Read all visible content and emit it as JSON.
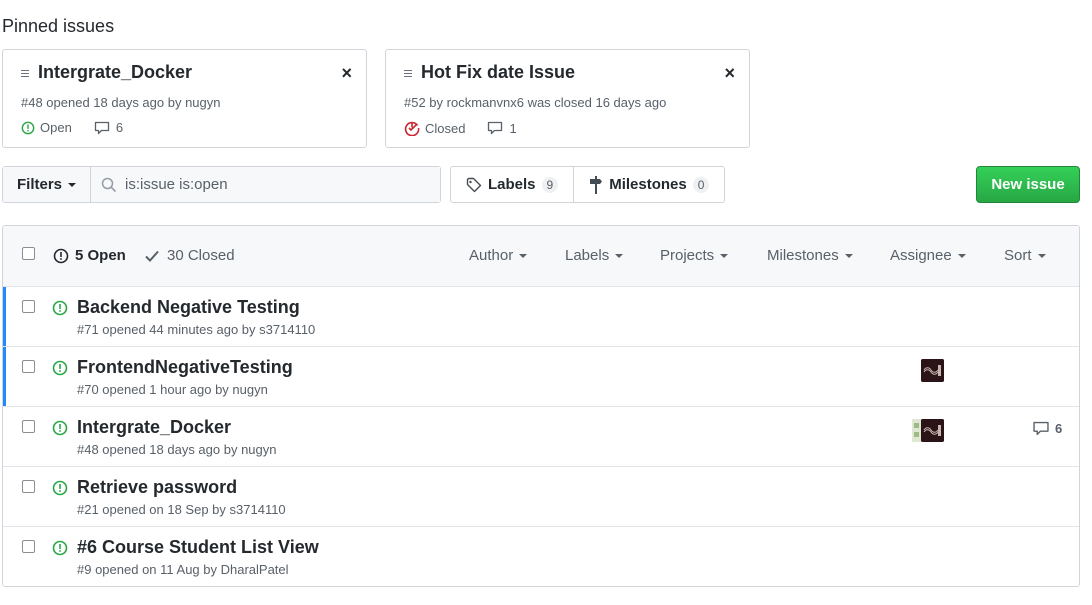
{
  "pinned": {
    "heading": "Pinned issues",
    "cards": [
      {
        "title": "Intergrate_Docker",
        "meta": "#48 opened 18 days ago by nugyn",
        "status": "Open",
        "comments": "6",
        "close": "×"
      },
      {
        "title": "Hot Fix date Issue",
        "meta": "#52 by rockmanvnx6 was closed 16 days ago",
        "status": "Closed",
        "comments": "1",
        "close": "×"
      }
    ]
  },
  "toolbar": {
    "filters_label": "Filters",
    "search_value": "is:issue is:open",
    "labels_label": "Labels",
    "labels_count": "9",
    "milestones_label": "Milestones",
    "milestones_count": "0",
    "new_issue_label": "New issue"
  },
  "list_header": {
    "open_label": "5 Open",
    "closed_label": "30 Closed",
    "filters": [
      "Author",
      "Labels",
      "Projects",
      "Milestones",
      "Assignee",
      "Sort"
    ]
  },
  "issues": [
    {
      "title": "Backend Negative Testing",
      "meta": "#71 opened 44 minutes ago by s3714110"
    },
    {
      "title": "FrontendNegativeTesting",
      "meta": "#70 opened 1 hour ago by nugyn"
    },
    {
      "title": "Intergrate_Docker",
      "meta": "#48 opened 18 days ago by nugyn",
      "comments": "6"
    },
    {
      "title": "Retrieve password",
      "meta": "#21 opened on 18 Sep by s3714110"
    },
    {
      "title": "#6 Course Student List View",
      "meta": "#9 opened on 11 Aug by DharalPatel"
    }
  ],
  "colors": {
    "open_green": "#28a745",
    "closed_red": "#cb2431",
    "unread_blue": "#2188ff",
    "button_green": "#2ea44f"
  }
}
